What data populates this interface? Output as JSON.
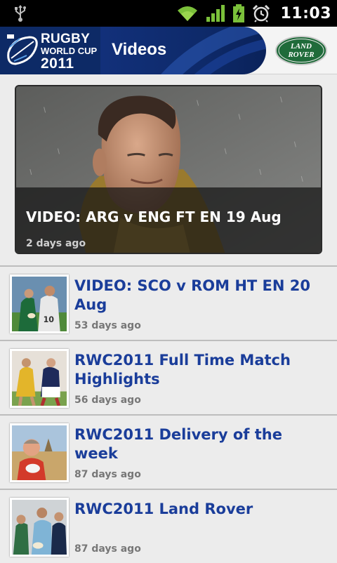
{
  "status_bar": {
    "time": "11:03",
    "icons": [
      "usb-icon",
      "wifi-icon",
      "signal-icon",
      "battery-charging-icon",
      "alarm-icon"
    ]
  },
  "header": {
    "logo": {
      "line1": "RUGBY",
      "line2": "WORLD CUP",
      "line3": "2011"
    },
    "title": "Videos",
    "sponsor": {
      "line1": "LAND",
      "line2": "ROVER"
    }
  },
  "featured": {
    "title": "VIDEO: ARG v ENG FT EN 19 Aug",
    "date": "2 days ago"
  },
  "videos": [
    {
      "title": "VIDEO: SCO v ROM HT EN 20 Aug",
      "date": "53 days ago"
    },
    {
      "title": "RWC2011 Full Time Match Highlights",
      "date": "56 days ago"
    },
    {
      "title": "RWC2011 Delivery of the week",
      "date": "87 days ago"
    },
    {
      "title": "RWC2011 Land Rover",
      "date": "87 days ago"
    }
  ],
  "colors": {
    "header_navy": "#0d2a66",
    "item_title_blue": "#1a3d9a",
    "sponsor_green": "#1f6b3a"
  }
}
